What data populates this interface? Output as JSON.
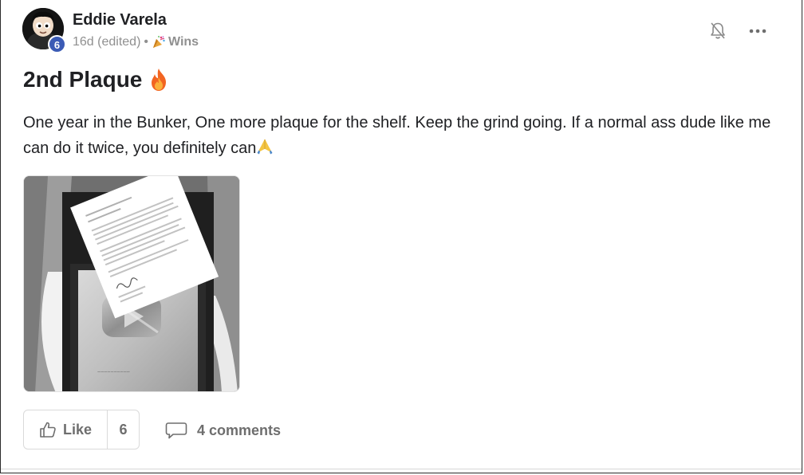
{
  "post": {
    "author": "Eddie Varela",
    "level": "6",
    "time": "16d (edited)",
    "separator": "•",
    "category_icon": "party-popper",
    "category": "Wins",
    "title": "2nd Plaque",
    "title_icon": "fire",
    "body": "One year in the Bunker, One more plaque for the shelf. Keep the grind going. If a normal ass dude like me can do it twice, you definitely can",
    "body_icon": "praying-hands",
    "image_icon": "plaque-photo"
  },
  "actions": {
    "like_label": "Like",
    "like_count": "6",
    "comments_label": "4 comments"
  },
  "colors": {
    "level_badge": "#3b5bb5",
    "text": "#202124",
    "muted": "#909090",
    "action_text": "#6e6e6e",
    "border": "#dadada"
  }
}
